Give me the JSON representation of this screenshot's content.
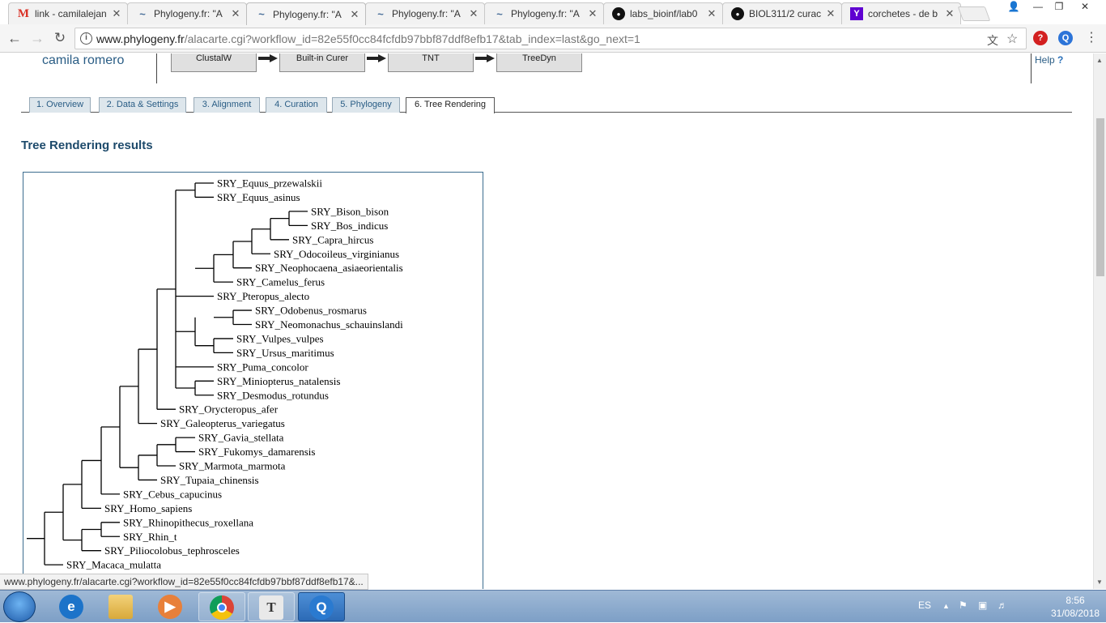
{
  "browser": {
    "tabs": [
      {
        "title": "link - camilalejan",
        "icon": "gmail-icon",
        "active": false
      },
      {
        "title": "Phylogeny.fr: \"A",
        "icon": "phylogeny-icon",
        "active": false
      },
      {
        "title": "Phylogeny.fr: \"A",
        "icon": "phylogeny-icon",
        "active": true
      },
      {
        "title": "Phylogeny.fr: \"A",
        "icon": "phylogeny-icon",
        "active": false
      },
      {
        "title": "Phylogeny.fr: \"A",
        "icon": "phylogeny-icon",
        "active": false
      },
      {
        "title": "labs_bioinf/lab0",
        "icon": "github-icon",
        "active": false
      },
      {
        "title": "BIOL311/2 curac",
        "icon": "github-icon",
        "active": false
      },
      {
        "title": "corchetes - de b",
        "icon": "yahoo-icon",
        "active": false
      }
    ],
    "url_host": "www.phylogeny.fr",
    "url_path": "/alacarte.cgi?workflow_id=82e55f0cc84fcfdb97bbf87ddf8efb17&tab_index=last&go_next=1"
  },
  "header": {
    "user_name": "camila romero",
    "workflow_steps": [
      "ClustalW",
      "Built-in Curer",
      "TNT",
      "TreeDyn"
    ],
    "help_label": "Help",
    "help_icon": "?"
  },
  "page_tabs": [
    {
      "label": "1. Overview",
      "active": false
    },
    {
      "label": "2. Data & Settings",
      "active": false
    },
    {
      "label": "3. Alignment",
      "active": false
    },
    {
      "label": "4. Curation",
      "active": false
    },
    {
      "label": "5. Phylogeny",
      "active": false
    },
    {
      "label": "6. Tree Rendering",
      "active": true
    }
  ],
  "results_title": "Tree Rendering results",
  "tree_leaves": [
    "SRY_Equus_przewalskii",
    "SRY_Equus_asinus",
    "SRY_Bison_bison",
    "SRY_Bos_indicus",
    "SRY_Capra_hircus",
    "SRY_Odocoileus_virginianus",
    "SRY_Neophocaena_asiaeorientalis",
    "SRY_Camelus_ferus",
    "SRY_Pteropus_alecto",
    "SRY_Odobenus_rosmarus",
    "SRY_Neomonachus_schauinslandi",
    "SRY_Vulpes_vulpes",
    "SRY_Ursus_maritimus",
    "SRY_Puma_concolor",
    "SRY_Miniopterus_natalensis",
    "SRY_Desmodus_rotundus",
    "SRY_Orycteropus_afer",
    "SRY_Galeopterus_variegatus",
    "SRY_Gavia_stellata",
    "SRY_Fukomys_damarensis",
    "SRY_Marmota_marmota",
    "SRY_Tupaia_chinensis",
    "SRY_Cebus_capucinus",
    "SRY_Homo_sapiens",
    "SRY_Rhinopithecus_roxellana",
    "SRY_Rhin_t",
    "SRY_Piliocolobus_tephrosceles",
    "SRY_Macaca_mulatta"
  ],
  "status_bar": "www.phylogeny.fr/alacarte.cgi?workflow_id=82e55f0cc84fcfdb97bbf87ddf8efb17&...",
  "taskbar": {
    "apps": [
      {
        "name": "internet-explorer",
        "icon": "ie-icon",
        "glyph": "e"
      },
      {
        "name": "file-explorer",
        "icon": "folder-icon",
        "glyph": ""
      },
      {
        "name": "media-player",
        "icon": "media-player-icon",
        "glyph": "▶"
      },
      {
        "name": "chrome",
        "icon": "chrome-icon",
        "glyph": ""
      },
      {
        "name": "text-editor",
        "icon": "text-editor-icon",
        "glyph": "T"
      },
      {
        "name": "search-app",
        "icon": "search-icon",
        "glyph": "Q"
      }
    ],
    "language": "ES",
    "time": "8:56",
    "date": "31/08/2018"
  }
}
